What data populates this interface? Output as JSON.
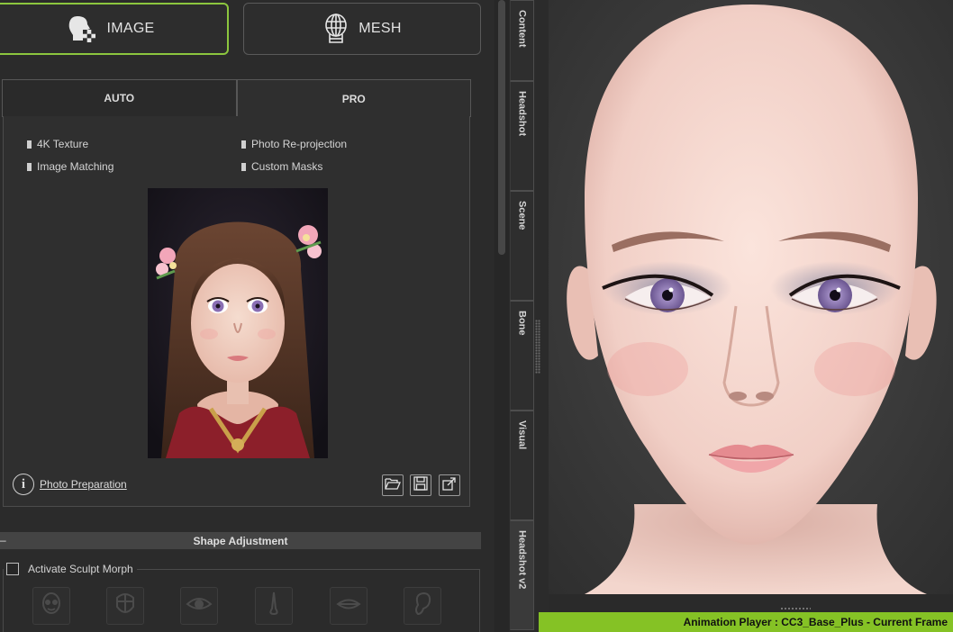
{
  "mode_buttons": {
    "image": "IMAGE",
    "mesh": "MESH"
  },
  "tabs": {
    "auto": "AUTO",
    "pro": "PRO"
  },
  "features": [
    "4K Texture",
    "Photo Re-projection",
    "Image Matching",
    "Custom Masks"
  ],
  "photo_preparation": "Photo Preparation",
  "shape_adjustment": {
    "title": "Shape Adjustment",
    "collapse": "–"
  },
  "sculpt": {
    "label": "Activate Sculpt Morph",
    "checked": false
  },
  "vertical_tabs": [
    "Content",
    "Headshot",
    "Scene",
    "Bone",
    "Visual",
    "Headshot v2"
  ],
  "status_bar": "Animation Player : CC3_Base_Plus - Current Frame",
  "colors": {
    "accent": "#8cc63e",
    "status_bar": "#85c225",
    "panel_bg": "#2b2b2b",
    "viewport_bg": "#3c3c3c"
  },
  "icons": [
    "photo-face-icon",
    "mesh-head-icon",
    "info-icon",
    "open-folder-icon",
    "save-icon",
    "export-icon",
    "morph-head-icon",
    "morph-face-icon",
    "morph-eye-icon",
    "morph-nose-icon",
    "morph-mouth-icon",
    "morph-ear-icon"
  ]
}
